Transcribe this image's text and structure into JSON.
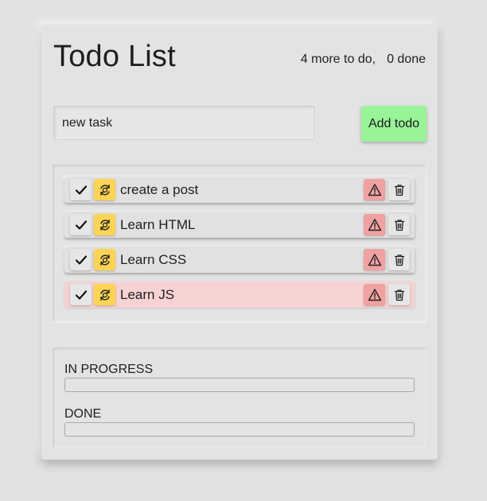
{
  "app": {
    "title": "Todo List",
    "counter": {
      "todo_text": "4 more to do,",
      "done_text": "0 done"
    }
  },
  "new_task": {
    "value": "new task",
    "add_label": "Add todo"
  },
  "todos": [
    {
      "label": "create a post",
      "urgent": false
    },
    {
      "label": "Learn HTML",
      "urgent": false
    },
    {
      "label": "Learn CSS",
      "urgent": false
    },
    {
      "label": "Learn JS",
      "urgent": true
    }
  ],
  "icons": {
    "complete": "check-icon",
    "in_progress": "refresh-icon",
    "urgent": "warning-icon",
    "delete": "trash-icon"
  },
  "sections": {
    "in_progress": {
      "heading": "IN PROGRESS",
      "items": []
    },
    "done": {
      "heading": "DONE",
      "items": []
    }
  },
  "colors": {
    "background": "#e2e2e2",
    "add_button": "#98f497",
    "in_progress_button": "#ffd454",
    "urgent_button": "#f0a1a1",
    "urgent_row": "#f6d2d2"
  }
}
